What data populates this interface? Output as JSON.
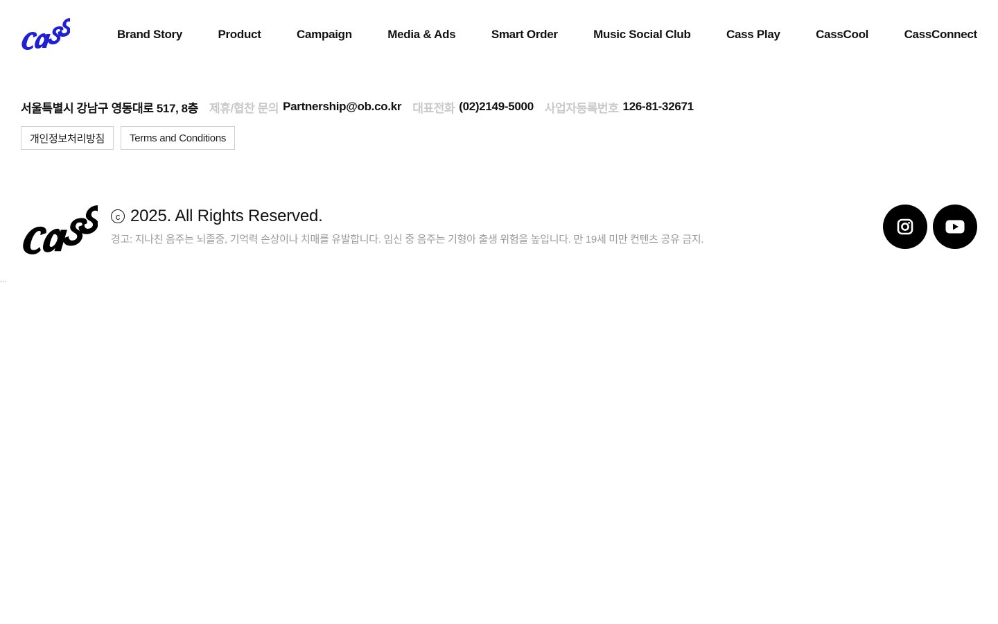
{
  "header": {
    "logo_text": "cass",
    "brand_color": "#1f1fd6",
    "nav_items": [
      "Brand Story",
      "Product",
      "Campaign",
      "Media & Ads",
      "Smart Order",
      "Music Social Club",
      "Cass Play",
      "CassCool",
      "CassConnect"
    ]
  },
  "company_info": {
    "address": "서울특별시 강남구 영동대로 517, 8층",
    "partnership_label": "제휴/협찬 문의",
    "partnership_email": "Partnership@ob.co.kr",
    "phone_label": "대표전화",
    "phone": "(02)2149-5000",
    "business_no_label": "사업자등록번호",
    "business_no": "126-81-32671"
  },
  "policies": {
    "privacy": "개인정보처리방침",
    "terms": "Terms and Conditions"
  },
  "footer": {
    "logo_text": "cass",
    "logo_color": "#000000",
    "copyright_mark": "c",
    "copyright": "2025. All Rights Reserved.",
    "warning": "경고: 지나친 음주는 뇌졸중, 기억력 손상이나 치매를 유발합니다. 임신 중 음주는 기형아 출생 위험을 높입니다. 만 19세 미만 컨텐츠 공유 금지.",
    "social": [
      "instagram-icon",
      "youtube-icon"
    ],
    "trailing_text": "..."
  }
}
